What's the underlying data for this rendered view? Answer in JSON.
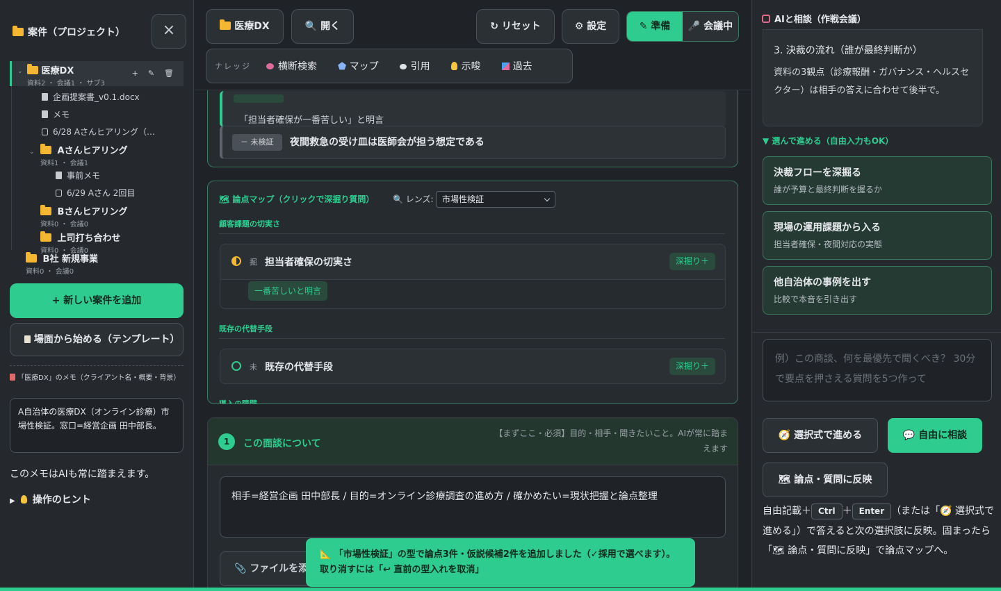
{
  "sidebar": {
    "title": "案件（プロジェクト）",
    "close_label": "×",
    "project": {
      "name": "医療DX",
      "meta": "資料2 ・ 会議1 ・ サブ3",
      "actions": [
        "+",
        "✎",
        "🗑"
      ]
    },
    "files": [
      "企画提案書_v0.1.docx",
      "メモ",
      "6/28 Aさんヒアリング（…"
    ],
    "sub_a": {
      "name": "Aさんヒアリング",
      "meta": "資料1 ・ 会議1",
      "files": [
        "事前メモ",
        "6/29 Aさん 2回目"
      ]
    },
    "sub_b": {
      "name": "Bさんヒアリング",
      "meta": "資料0 ・ 会議0"
    },
    "sub_c": {
      "name": "上司打ち合わせ",
      "meta": "資料0 ・ 会議0"
    },
    "project2": {
      "name": "B社 新規事業",
      "meta": "資料0 ・ 会議0"
    },
    "add_button": "+ 新しい案件を追加",
    "template_button": "場面から始める（テンプレート）",
    "memo_label": "「医療DX」のメモ（クライアント名・概要・背景）",
    "memo_text": "A自治体の医療DX（オンライン診療）市場性検証。窓口=経営企画 田中部長。",
    "memo_note": "このメモはAIも常に踏まえます。",
    "hint": "操作のヒント"
  },
  "toolbar": {
    "project_button": "医療DX",
    "open_button": "開く",
    "reset_button": "リセット",
    "settings_button": "設定",
    "mode_prep": "準備",
    "mode_meeting": "会議中",
    "knowledge_label": "ナレッジ",
    "knowledge_items": [
      "横断検索",
      "マップ",
      "引用",
      "示唆",
      "過去"
    ]
  },
  "evidence": {
    "quote_text": "「担当者確保が一番苦しい」と明言",
    "unverified_badge": "－ 未検証",
    "hypothesis": "夜間救急の受け皿は医師会が担う想定である"
  },
  "issue_map": {
    "heading": "論点マップ（クリックで深掘り質問）",
    "lens_label": "レンズ:",
    "lens_value": "市場性検証",
    "section1": "顧客課題の切実さ",
    "issue1": {
      "mark": "掘",
      "name": "担当者確保の切実さ",
      "dig": "深掘り＋",
      "chip": "一番苦しいと明言"
    },
    "section2": "既存の代替手段",
    "issue2": {
      "mark": "未",
      "name": "既存の代替手段",
      "dig": "深掘り＋"
    },
    "section3": "導入の障壁"
  },
  "meeting": {
    "number": "1",
    "title": "この面談について",
    "required_note": "【まずここ・必須】目的・相手・聞きたいこと。AIが常に踏まえます",
    "text": "相手=経営企画 田中部長 / 目的=オンライン診療調査の進め方 / 確かめたい=現状把握と論点整理",
    "file_button": "ファイルを添"
  },
  "toast": "「市場性検証」の型で論点3件・仮説候補2件を追加しました（✓採用で選べます）。取り消すには「↩ 直前の型入れを取消」",
  "right": {
    "title": "AIと相談（作戦会議）",
    "msg_line1": "3. 決裁の流れ（誰が最終判断か）",
    "msg_line2": "資料の3観点（診療報酬・ガバナンス・ヘルスセクター）は相手の答えに合わせて後半で。",
    "pick_label": "▼ 選んで進める（自由入力もOK）",
    "options": [
      {
        "title": "決裁フローを深掘る",
        "sub": "誰が予算と最終判断を握るか"
      },
      {
        "title": "現場の運用課題から入る",
        "sub": "担当者確保・夜間対応の実態"
      },
      {
        "title": "他自治体の事例を出す",
        "sub": "比較で本音を引き出す"
      }
    ],
    "input_placeholder": "例）この商談、何を最優先で聞くべき？ 30分で要点を押さえる質問を5つ作って",
    "btn_select": "選択式で進める",
    "btn_free": "自由に相談",
    "btn_reflect": "論点・質問に反映",
    "tip_a": "自由記載＋",
    "kbd_ctrl": "Ctrl",
    "tip_plus": "＋",
    "kbd_enter": "Enter",
    "tip_b": "（または「🧭 選択式で進める」）で答えると次の選択肢に反映。固まったら「🗺 論点・質問に反映」で論点マップへ。"
  }
}
